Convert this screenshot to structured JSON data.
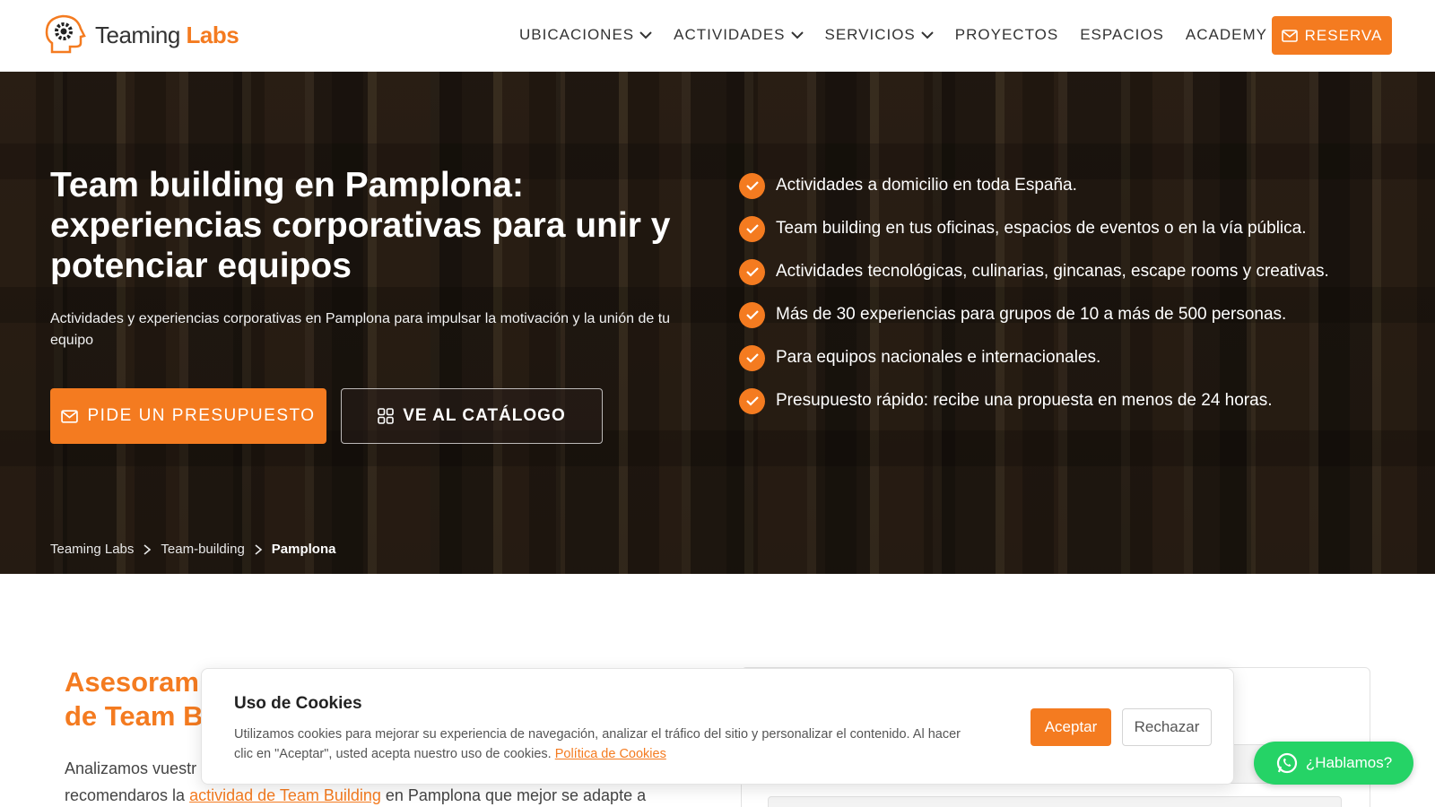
{
  "header": {
    "logo_text_main": "Teaming",
    "logo_text_accent": "Labs",
    "nav": [
      {
        "label": "UBICACIONES",
        "dropdown": true
      },
      {
        "label": "ACTIVIDADES",
        "dropdown": true
      },
      {
        "label": "SERVICIOS",
        "dropdown": true
      },
      {
        "label": "PROYECTOS",
        "dropdown": false
      },
      {
        "label": "ESPACIOS",
        "dropdown": false
      },
      {
        "label": "ACADEMY",
        "dropdown": false
      }
    ],
    "reserve_label": "RESERVA"
  },
  "hero": {
    "title": "Team building en Pamplona: experiencias corporativas para unir y potenciar equipos",
    "subtitle": "Actividades y experiencias corporativas en Pamplona para impulsar la motivación y la unión de tu equipo",
    "quote_button": "PIDE UN PRESUPUESTO",
    "catalog_button": "VE AL CATÁLOGO",
    "features": [
      "Actividades a domicilio en toda España.",
      "Team building en tus oficinas, espacios de eventos o en la vía pública.",
      "Actividades tecnológicas, culinarias, gincanas, escape rooms y creativas.",
      "Más de 30 experiencias para grupos de 10 a más de 500 personas.",
      "Para equipos nacionales e internacionales.",
      "Presupuesto rápido: recibe una propuesta en menos de 24 horas."
    ],
    "breadcrumb": [
      "Teaming Labs",
      "Team-building",
      "Pamplona"
    ]
  },
  "section": {
    "title_line1": "Asesoram",
    "title_line2": "de Team B",
    "text_start": "Analizamos vuestr",
    "text_line2_prefix": "recomendaros la ",
    "text_link": "actividad de Team Building",
    "text_line2_suffix": " en Pamplona que mejor se adapte a"
  },
  "cookie": {
    "title": "Uso de Cookies",
    "text": "Utilizamos cookies para mejorar su experiencia de navegación, analizar el tráfico del sitio y personalizar el contenido. Al hacer clic en \"Aceptar\", usted acepta nuestro uso de cookies. ",
    "link": "Política de Cookies",
    "accept": "Aceptar",
    "reject": "Rechazar"
  },
  "whatsapp": {
    "label": "¿Hablamos?"
  },
  "colors": {
    "accent": "#f47b20",
    "whatsapp": "#25d366"
  }
}
